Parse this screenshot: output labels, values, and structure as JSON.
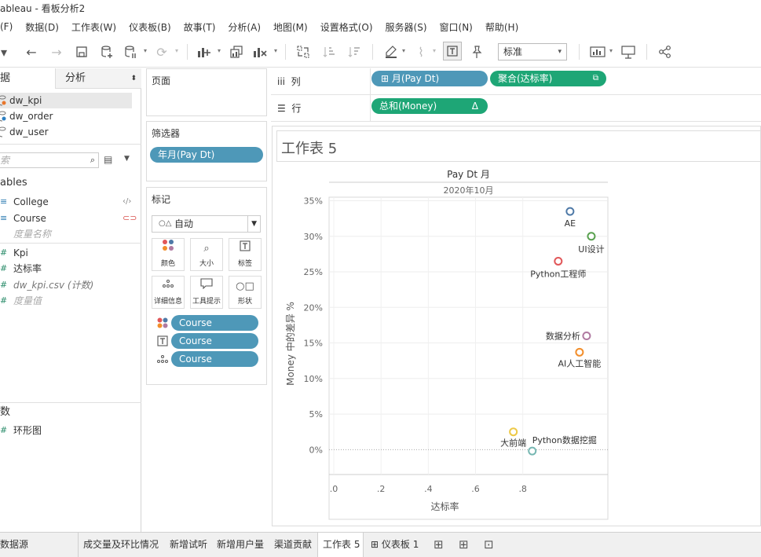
{
  "window": {
    "title": "ableau - 看板分析2"
  },
  "menu": [
    "(F)",
    "数据(D)",
    "工作表(W)",
    "仪表板(B)",
    "故事(T)",
    "分析(A)",
    "地图(M)",
    "设置格式(O)",
    "服务器(S)",
    "窗口(N)",
    "帮助(H)"
  ],
  "toolbar": {
    "view_mode": "标准"
  },
  "left_panel": {
    "tab_data": "据",
    "tab_analysis": "分析",
    "datasources": [
      "dw_kpi",
      "dw_order",
      "dw_user"
    ],
    "search_placeholder": "索",
    "tables_header": "ables",
    "dimensions": [
      "College",
      "Course",
      "度量名称"
    ],
    "measures": [
      "Kpi",
      "达标率",
      "dw_kpi.csv (计数)",
      "度量值"
    ],
    "params_header": "数",
    "params": [
      "环形图"
    ]
  },
  "cards": {
    "pages_title": "页面",
    "filters_title": "筛选器",
    "filter_pill": "年月(Pay Dt)",
    "marks_title": "标记",
    "marks_type": "自动",
    "mark_buttons": [
      "颜色",
      "大小",
      "标签",
      "详细信息",
      "工具提示",
      "形状"
    ],
    "mark_pills": [
      "Course",
      "Course",
      "Course"
    ]
  },
  "shelves": {
    "columns_label": "列",
    "rows_label": "行",
    "col_pill_1": "月(Pay Dt)",
    "col_pill_2": "聚合(达标率)",
    "row_pill_1": "总和(Money)",
    "row_pill_1_icon": "Δ"
  },
  "sheet": {
    "title": "工作表 5"
  },
  "chart_data": {
    "type": "scatter",
    "header_field": "Pay Dt 月",
    "header_value": "2020年10月",
    "xlabel": "达标率",
    "ylabel": "Money 中的差异 %",
    "x_ticks": [
      ".0",
      ".2",
      ".4",
      ".6",
      ".8"
    ],
    "x_tick_values": [
      0.0,
      0.2,
      0.4,
      0.6,
      0.8
    ],
    "y_ticks": [
      "0%",
      "5%",
      "10%",
      "15%",
      "20%",
      "25%",
      "30%",
      "35%"
    ],
    "y_tick_values": [
      0,
      5,
      10,
      15,
      20,
      25,
      30,
      35
    ],
    "xlim": [
      -0.02,
      1.16
    ],
    "ylim": [
      -3.5,
      35.5
    ],
    "points": [
      {
        "label": "AE",
        "x": 1.0,
        "y": 33.5,
        "color": "#4e79a7"
      },
      {
        "label": "UI设计",
        "x": 1.09,
        "y": 30.0,
        "color": "#59a14f"
      },
      {
        "label": "Python工程师",
        "x": 0.95,
        "y": 26.5,
        "color": "#e15759"
      },
      {
        "label": "数据分析",
        "x": 1.07,
        "y": 16.0,
        "color": "#b07aa1"
      },
      {
        "label": "AI人工智能",
        "x": 1.04,
        "y": 13.7,
        "color": "#f28e2b"
      },
      {
        "label": "大前端",
        "x": 0.76,
        "y": 2.5,
        "color": "#edc948"
      },
      {
        "label": "Python数据挖掘",
        "x": 0.84,
        "y": -0.2,
        "color": "#76b7b2"
      }
    ]
  },
  "bottom_tabs": [
    "数据源",
    "成交量及环比情况",
    "新增试听",
    "新增用户量",
    "渠道贡献",
    "工作表 5",
    "仪表板 1"
  ]
}
